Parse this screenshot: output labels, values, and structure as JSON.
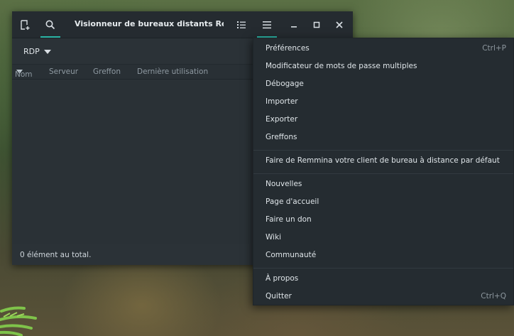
{
  "window": {
    "title": "Visionneur de bureaux distants Remm...",
    "protocol": "RDP",
    "columns": [
      "Nom",
      "Serveur",
      "Greffon",
      "Dernière utilisation"
    ],
    "status": "0 élément au total."
  },
  "headerbar_icons": [
    "new-connection-icon",
    "search-icon",
    "list-view-icon",
    "hamburger-menu-icon",
    "minimize-icon",
    "maximize-icon",
    "close-icon"
  ],
  "menu": {
    "groups": [
      [
        {
          "label": "Préférences",
          "accel": "Ctrl+P"
        },
        {
          "label": "Modificateur de mots de passe multiples",
          "accel": ""
        },
        {
          "label": "Débogage",
          "accel": ""
        },
        {
          "label": "Importer",
          "accel": ""
        },
        {
          "label": "Exporter",
          "accel": ""
        },
        {
          "label": "Greffons",
          "accel": ""
        }
      ],
      [
        {
          "label": "Faire de Remmina votre client de bureau à distance par défaut",
          "accel": ""
        }
      ],
      [
        {
          "label": "Nouvelles",
          "accel": ""
        },
        {
          "label": "Page d'accueil",
          "accel": ""
        },
        {
          "label": "Faire un don",
          "accel": ""
        },
        {
          "label": "Wiki",
          "accel": ""
        },
        {
          "label": "Communauté",
          "accel": ""
        }
      ],
      [
        {
          "label": "À propos",
          "accel": ""
        },
        {
          "label": "Quitter",
          "accel": "Ctrl+Q"
        }
      ]
    ]
  },
  "colors": {
    "accent": "#2bb5a6",
    "window_bg": "#2b3237",
    "menu_bg": "#252c31"
  }
}
